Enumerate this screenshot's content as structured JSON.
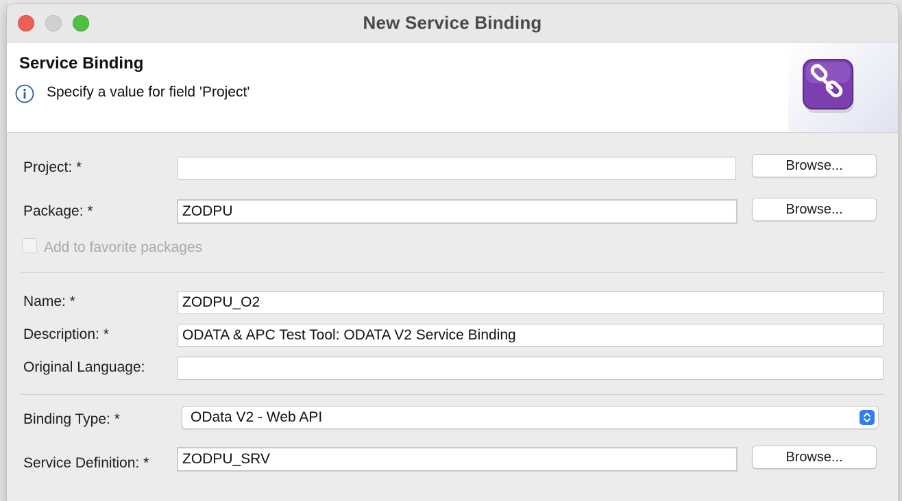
{
  "window": {
    "title": "New Service Binding"
  },
  "banner": {
    "title": "Service Binding",
    "message": "Specify a value for field 'Project'"
  },
  "form": {
    "project": {
      "label": "Project: *",
      "value": "",
      "browse": "Browse..."
    },
    "package": {
      "label": "Package: *",
      "value": "ZODPU",
      "browse": "Browse..."
    },
    "favorite": {
      "label": "Add to favorite packages",
      "checked": false,
      "enabled": false
    },
    "name": {
      "label": "Name: *",
      "value": "ZODPU_O2"
    },
    "description": {
      "label": "Description: *",
      "value": "ODATA & APC Test Tool: ODATA V2 Service Binding"
    },
    "original_language": {
      "label": "Original Language:",
      "value": ""
    },
    "binding_type": {
      "label": "Binding Type: *",
      "value": "OData V2 - Web API"
    },
    "service_definition": {
      "label": "Service Definition: *",
      "value": "ZODPU_SRV",
      "browse": "Browse..."
    }
  },
  "colors": {
    "close": "#ee5e57",
    "maximize": "#4fc03f",
    "accent": "#2f7cf6",
    "wizard_icon": "#7c3fb0"
  },
  "icons": {
    "info": "info-icon",
    "wizard": "service-binding-icon",
    "select": "updown-arrows-icon"
  }
}
